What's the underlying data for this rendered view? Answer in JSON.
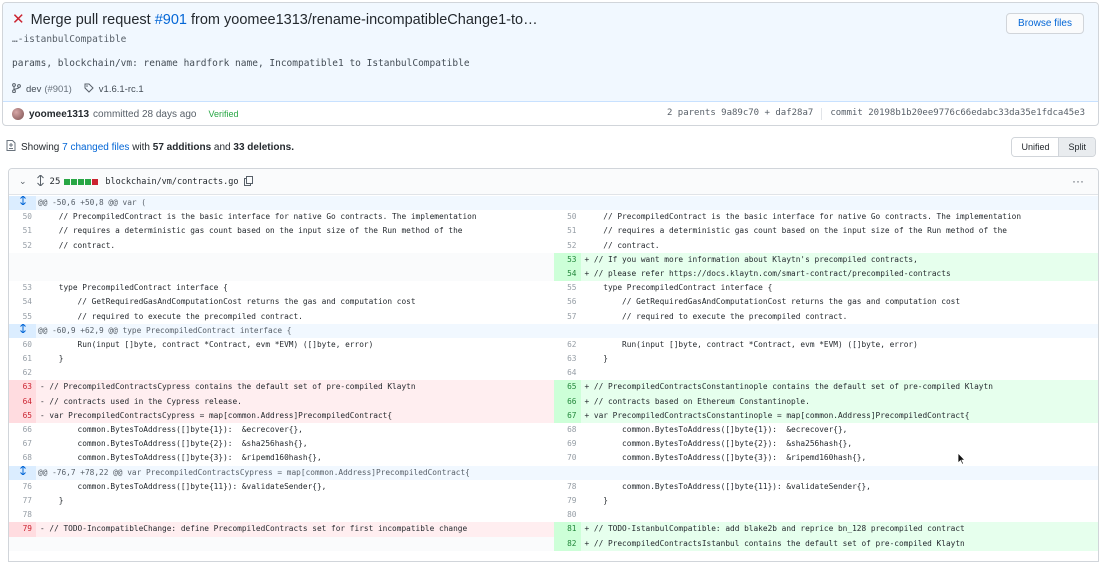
{
  "header": {
    "status_icon": "x-icon",
    "title_prefix": "Merge pull request ",
    "pr_number": "#901",
    "title_suffix": " from yoomee1313/rename-incompatibleChange1-to…",
    "subtitle": "…-istanbulCompatible",
    "message": "params, blockchain/vm: rename hardfork name, Incompatible1 to IstanbulCompatible",
    "branch": "dev",
    "branch_pr": "(#901)",
    "tag": "v1.6.1-rc.1",
    "browse_button": "Browse files"
  },
  "author_row": {
    "author": "yoomee1313",
    "committed": "committed 28 days ago",
    "verified": "Verified",
    "parents_label": "2 parents",
    "parent1": "9a89c70",
    "plus": "+",
    "parent2": "daf28a7",
    "commit_label": "commit",
    "commit_hash": "20198b1b20ee9776c66edabc33da35e1fdca45e3"
  },
  "summary": {
    "showing": "Showing",
    "changed_files": "7 changed files",
    "with": "with",
    "additions": "57 additions",
    "and": "and",
    "deletions": "33 deletions."
  },
  "view_toggle": {
    "unified": "Unified",
    "split": "Split",
    "selected": "split"
  },
  "file": {
    "changes": "25",
    "bars": [
      "#28a745",
      "#28a745",
      "#28a745",
      "#28a745",
      "#cb2431"
    ],
    "path": "blockchain/vm/contracts.go",
    "kebab": "···"
  },
  "diff_rows": [
    {
      "type": "hunk",
      "text": "@@ -50,6 +50,8 @@ var ("
    },
    {
      "type": "ctx",
      "ln": "50",
      "lc": "    // PrecompiledContract is the basic interface for native Go contracts. The implementation",
      "rn": "50",
      "rc": "    // PrecompiledContract is the basic interface for native Go contracts. The implementation"
    },
    {
      "type": "ctx",
      "ln": "51",
      "lc": "    // requires a deterministic gas count based on the input size of the Run method of the",
      "rn": "51",
      "rc": "    // requires a deterministic gas count based on the input size of the Run method of the"
    },
    {
      "type": "ctx",
      "ln": "52",
      "lc": "    // contract.",
      "rn": "52",
      "rc": "    // contract."
    },
    {
      "type": "addonly",
      "rn": "53",
      "rc": "+ // If you want more information about Klaytn's precompiled contracts,"
    },
    {
      "type": "addonly",
      "rn": "54",
      "rc": "+ // please refer https://docs.klaytn.com/smart-contract/precompiled-contracts"
    },
    {
      "type": "ctx",
      "ln": "53",
      "lc": "    type PrecompiledContract interface {",
      "rn": "55",
      "rc": "    type PrecompiledContract interface {"
    },
    {
      "type": "ctx",
      "ln": "54",
      "lc": "        // GetRequiredGasAndComputationCost returns the gas and computation cost",
      "rn": "56",
      "rc": "        // GetRequiredGasAndComputationCost returns the gas and computation cost"
    },
    {
      "type": "ctx",
      "ln": "55",
      "lc": "        // required to execute the precompiled contract.",
      "rn": "57",
      "rc": "        // required to execute the precompiled contract."
    },
    {
      "type": "hunk",
      "text": "@@ -60,9 +62,9 @@ type PrecompiledContract interface {"
    },
    {
      "type": "ctx",
      "ln": "60",
      "lc": "        Run(input []byte, contract *Contract, evm *EVM) ([]byte, error)",
      "rn": "62",
      "rc": "        Run(input []byte, contract *Contract, evm *EVM) ([]byte, error)"
    },
    {
      "type": "ctx",
      "ln": "61",
      "lc": "    }",
      "rn": "63",
      "rc": "    }"
    },
    {
      "type": "ctx",
      "ln": "62",
      "lc": "",
      "rn": "64",
      "rc": ""
    },
    {
      "type": "change",
      "ln": "63",
      "lc": "- // PrecompiledContractsCypress contains the default set of pre-compiled Klaytn",
      "rn": "65",
      "rc": "+ // PrecompiledContractsConstantinople contains the default set of pre-compiled Klaytn"
    },
    {
      "type": "change",
      "ln": "64",
      "lc": "- // contracts used in the Cypress release.",
      "rn": "66",
      "rc": "+ // contracts based on Ethereum Constantinople."
    },
    {
      "type": "change",
      "ln": "65",
      "lc": "- var PrecompiledContractsCypress = map[common.Address]PrecompiledContract{",
      "rn": "67",
      "rc": "+ var PrecompiledContractsConstantinople = map[common.Address]PrecompiledContract{"
    },
    {
      "type": "ctx",
      "ln": "66",
      "lc": "        common.BytesToAddress([]byte{1}):  &ecrecover{},",
      "rn": "68",
      "rc": "        common.BytesToAddress([]byte{1}):  &ecrecover{},"
    },
    {
      "type": "ctx",
      "ln": "67",
      "lc": "        common.BytesToAddress([]byte{2}):  &sha256hash{},",
      "rn": "69",
      "rc": "        common.BytesToAddress([]byte{2}):  &sha256hash{},"
    },
    {
      "type": "ctx",
      "ln": "68",
      "lc": "        common.BytesToAddress([]byte{3}):  &ripemd160hash{},",
      "rn": "70",
      "rc": "        common.BytesToAddress([]byte{3}):  &ripemd160hash{},"
    },
    {
      "type": "hunk",
      "text": "@@ -76,7 +78,22 @@ var PrecompiledContractsCypress = map[common.Address]PrecompiledContract{"
    },
    {
      "type": "ctx",
      "ln": "76",
      "lc": "        common.BytesToAddress([]byte{11}): &validateSender{},",
      "rn": "78",
      "rc": "        common.BytesToAddress([]byte{11}): &validateSender{},"
    },
    {
      "type": "ctx",
      "ln": "77",
      "lc": "    }",
      "rn": "79",
      "rc": "    }"
    },
    {
      "type": "ctx",
      "ln": "78",
      "lc": "",
      "rn": "80",
      "rc": ""
    },
    {
      "type": "change",
      "ln": "79",
      "lc": "- // TODO-IncompatibleChange: define PrecompiledContracts set for first incompatible change",
      "rn": "81",
      "rc": "+ // TODO-IstanbulCompatible: add blake2b and reprice bn_128 precompiled contract"
    },
    {
      "type": "addonly",
      "rn": "82",
      "rc": "+ // PrecompiledContractsIstanbul contains the default set of pre-compiled Klaytn"
    }
  ]
}
